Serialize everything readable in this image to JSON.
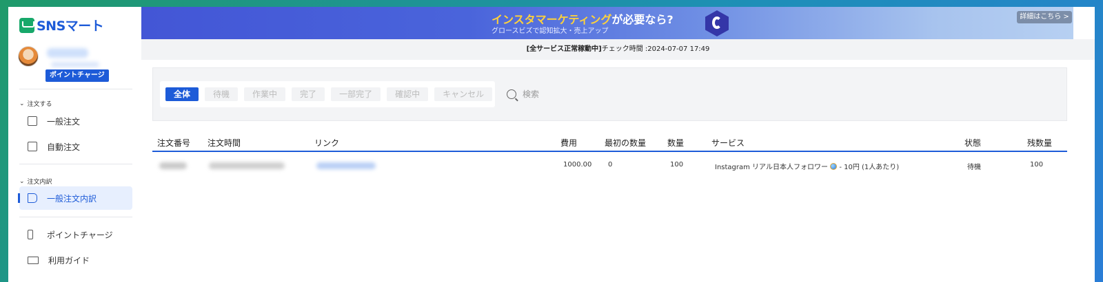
{
  "brand": {
    "logo_text": "SNSマート",
    "logo_icon": "cart-icon"
  },
  "user": {
    "charge_badge": "ポイントチャージ"
  },
  "sidebar": {
    "sections": [
      {
        "label": "注文する",
        "items": [
          {
            "label": "一般注文",
            "icon": "order-icon"
          },
          {
            "label": "自動注文",
            "icon": "auto-order-icon"
          }
        ]
      },
      {
        "label": "注文内訳",
        "items": [
          {
            "label": "一般注文内訳",
            "icon": "document-icon",
            "active": true
          }
        ]
      }
    ],
    "bottom_items": [
      {
        "label": "ポイントチャージ",
        "icon": "point-icon"
      },
      {
        "label": "利用ガイド",
        "icon": "book-icon"
      }
    ]
  },
  "banner": {
    "title_highlight": "インスタマーケティング",
    "title_rest": "が必要なら?",
    "subtitle": "グロースビズで認知拡大・売上アップ",
    "button": "詳細はこちら >"
  },
  "status": {
    "label": "[全サービス正常稼動中]",
    "check_text": "チェック時間 :2024-07-07 17:49"
  },
  "filters": {
    "tabs": [
      "全体",
      "待機",
      "作業中",
      "完了",
      "一部完了",
      "確認中",
      "キャンセル"
    ],
    "active_tab": "全体",
    "search_label": "検索"
  },
  "table": {
    "headers": [
      "注文番号",
      "注文時間",
      "リンク",
      "費用",
      "最初の数量",
      "数量",
      "サービス",
      "状態",
      "残数量"
    ],
    "rows": [
      {
        "cost": "1000.00",
        "start_count": "0",
        "quantity": "100",
        "service": "Instagram リアル日本人フォロワー",
        "service_suffix": " - 10円 (1人あたり)",
        "status": "待機",
        "remains": "100"
      }
    ]
  },
  "colors": {
    "accent": "#1d5bd8",
    "highlight": "#ffd23a"
  }
}
